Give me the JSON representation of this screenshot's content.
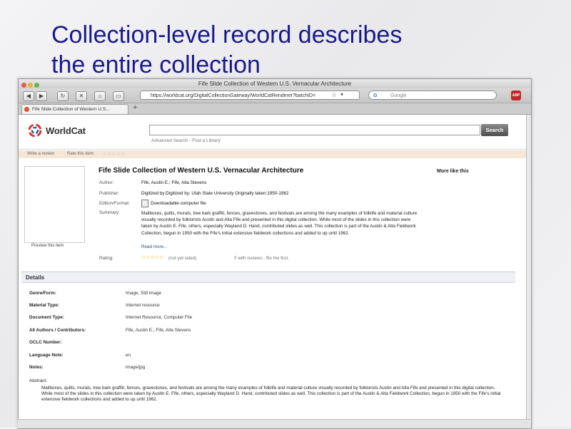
{
  "slide": {
    "title_line1": "Collection-level record describes",
    "title_line2": "the entire collection"
  },
  "browser": {
    "window_title": "Fife Slide Collection of Western U.S. Vernacular Architecture",
    "url": "https://worldcat.org/DigitalCollectionGateway/WorldCatRenderer?batchID=",
    "search_placeholder": "Google",
    "tab_label": "Fife Slide Collection of Western U.S...",
    "new_tab_label": "+",
    "adblock_label": "ABP",
    "icons": [
      "back-icon",
      "forward-icon",
      "reload-icon",
      "stop-icon",
      "home-icon",
      "bookmark-icon",
      "star-icon",
      "google-icon"
    ]
  },
  "worldcat": {
    "logo_text": "WorldCat",
    "search_button": "Search",
    "search_links": "Advanced Search · Find a Library",
    "review_bar": {
      "write_review": "Write a review",
      "rate_item": "Rate this item:"
    }
  },
  "record": {
    "title": "Fife Slide Collection of Western U.S. Vernacular Architecture",
    "more_like_this": "More like this",
    "preview_label": "Preview this item",
    "fields": [
      {
        "label": "Author:",
        "value": "Fife, Austin E.; Fife, Alta Stevens"
      },
      {
        "label": "Publisher:",
        "value": "Digitized by:Digitized by: Utah State University Originally taken:1950-1962"
      },
      {
        "label": "Edition/Format:",
        "value": "Downloadable computer file"
      }
    ],
    "summary_label": "Summary:",
    "summary": "Mailboxes, quilts, murals, tree bark graffiti, fences, gravestones, and festivals are among the many examples of folklife and material culture visually recorded by folklorists Austin and Alta Fife and presented in this digital collection. While most of the slides in this collection were taken by Austin E. Fife, others, especially Wayland D. Hand, contributed slides as well. This collection is part of the Austin & Alta Fieldwork Collection, begun in 1950 with the Fife's initial extensive fieldwork collections and added to up until 1962.",
    "read_more": "Read more...",
    "rating_label": "Rating:",
    "rating_note": "(not yet rated)",
    "reviews_note": "0 with reviews - Be the first."
  },
  "details": {
    "header": "Details",
    "rows": [
      {
        "label": "Genre/Form:",
        "value": "Image, Still image"
      },
      {
        "label": "Material Type:",
        "value": "Internet resource"
      },
      {
        "label": "Document Type:",
        "value": "Internet Resource, Computer File"
      },
      {
        "label": "All Authors / Contributors:",
        "value": "Fife, Austin E.; Fife, Alta Stevens"
      },
      {
        "label": "OCLC Number:",
        "value": ""
      },
      {
        "label": "Language Note:",
        "value": "en"
      },
      {
        "label": "Notes:",
        "value": "image/jpg"
      }
    ],
    "abstract_label": "Abstract:",
    "abstract": "Mailboxes, quilts, murals, tree bark graffiti, fences, gravestones, and festivals are among the many examples of folklife and material culture visually recorded by folklorists Austin and Alta Fife and presented in this digital collection. While most of the slides in this collection were taken by Austin E. Fife, others, especially Wayland D. Hand, contributed slides as well. This collection is part of the Austin & Alta Fieldwork Collection, begun in 1950 with the Fife's initial extensive fieldwork collections and added to up until 1962."
  },
  "colors": {
    "title": "#1a1a8c",
    "review_bar": "#f5e6d8",
    "search_button": "#4e4e4e",
    "stars": "#e0a800"
  }
}
